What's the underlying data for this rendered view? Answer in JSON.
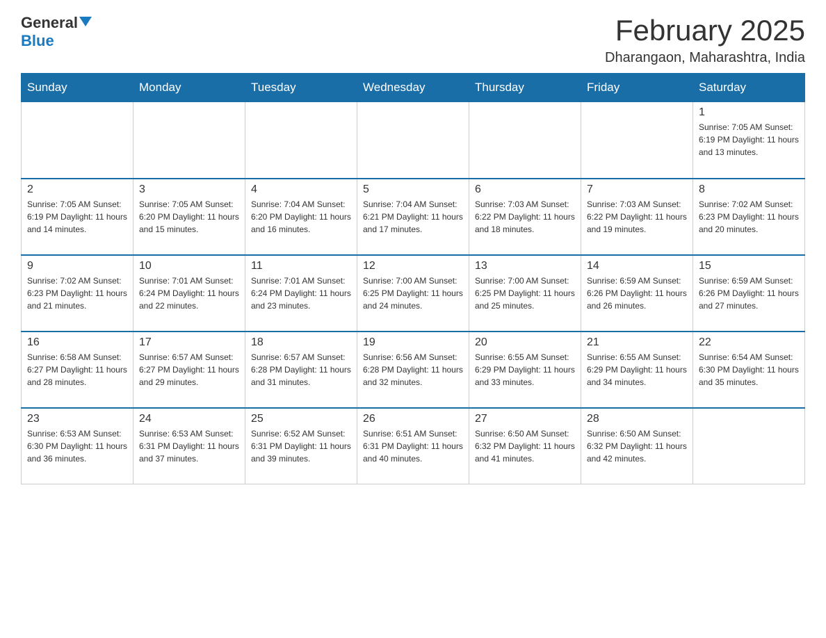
{
  "header": {
    "logo_general": "General",
    "logo_blue": "Blue",
    "month_title": "February 2025",
    "location": "Dharangaon, Maharashtra, India"
  },
  "days_of_week": [
    "Sunday",
    "Monday",
    "Tuesday",
    "Wednesday",
    "Thursday",
    "Friday",
    "Saturday"
  ],
  "weeks": [
    {
      "days": [
        {
          "num": "",
          "info": ""
        },
        {
          "num": "",
          "info": ""
        },
        {
          "num": "",
          "info": ""
        },
        {
          "num": "",
          "info": ""
        },
        {
          "num": "",
          "info": ""
        },
        {
          "num": "",
          "info": ""
        },
        {
          "num": "1",
          "info": "Sunrise: 7:05 AM\nSunset: 6:19 PM\nDaylight: 11 hours and 13 minutes."
        }
      ]
    },
    {
      "days": [
        {
          "num": "2",
          "info": "Sunrise: 7:05 AM\nSunset: 6:19 PM\nDaylight: 11 hours and 14 minutes."
        },
        {
          "num": "3",
          "info": "Sunrise: 7:05 AM\nSunset: 6:20 PM\nDaylight: 11 hours and 15 minutes."
        },
        {
          "num": "4",
          "info": "Sunrise: 7:04 AM\nSunset: 6:20 PM\nDaylight: 11 hours and 16 minutes."
        },
        {
          "num": "5",
          "info": "Sunrise: 7:04 AM\nSunset: 6:21 PM\nDaylight: 11 hours and 17 minutes."
        },
        {
          "num": "6",
          "info": "Sunrise: 7:03 AM\nSunset: 6:22 PM\nDaylight: 11 hours and 18 minutes."
        },
        {
          "num": "7",
          "info": "Sunrise: 7:03 AM\nSunset: 6:22 PM\nDaylight: 11 hours and 19 minutes."
        },
        {
          "num": "8",
          "info": "Sunrise: 7:02 AM\nSunset: 6:23 PM\nDaylight: 11 hours and 20 minutes."
        }
      ]
    },
    {
      "days": [
        {
          "num": "9",
          "info": "Sunrise: 7:02 AM\nSunset: 6:23 PM\nDaylight: 11 hours and 21 minutes."
        },
        {
          "num": "10",
          "info": "Sunrise: 7:01 AM\nSunset: 6:24 PM\nDaylight: 11 hours and 22 minutes."
        },
        {
          "num": "11",
          "info": "Sunrise: 7:01 AM\nSunset: 6:24 PM\nDaylight: 11 hours and 23 minutes."
        },
        {
          "num": "12",
          "info": "Sunrise: 7:00 AM\nSunset: 6:25 PM\nDaylight: 11 hours and 24 minutes."
        },
        {
          "num": "13",
          "info": "Sunrise: 7:00 AM\nSunset: 6:25 PM\nDaylight: 11 hours and 25 minutes."
        },
        {
          "num": "14",
          "info": "Sunrise: 6:59 AM\nSunset: 6:26 PM\nDaylight: 11 hours and 26 minutes."
        },
        {
          "num": "15",
          "info": "Sunrise: 6:59 AM\nSunset: 6:26 PM\nDaylight: 11 hours and 27 minutes."
        }
      ]
    },
    {
      "days": [
        {
          "num": "16",
          "info": "Sunrise: 6:58 AM\nSunset: 6:27 PM\nDaylight: 11 hours and 28 minutes."
        },
        {
          "num": "17",
          "info": "Sunrise: 6:57 AM\nSunset: 6:27 PM\nDaylight: 11 hours and 29 minutes."
        },
        {
          "num": "18",
          "info": "Sunrise: 6:57 AM\nSunset: 6:28 PM\nDaylight: 11 hours and 31 minutes."
        },
        {
          "num": "19",
          "info": "Sunrise: 6:56 AM\nSunset: 6:28 PM\nDaylight: 11 hours and 32 minutes."
        },
        {
          "num": "20",
          "info": "Sunrise: 6:55 AM\nSunset: 6:29 PM\nDaylight: 11 hours and 33 minutes."
        },
        {
          "num": "21",
          "info": "Sunrise: 6:55 AM\nSunset: 6:29 PM\nDaylight: 11 hours and 34 minutes."
        },
        {
          "num": "22",
          "info": "Sunrise: 6:54 AM\nSunset: 6:30 PM\nDaylight: 11 hours and 35 minutes."
        }
      ]
    },
    {
      "days": [
        {
          "num": "23",
          "info": "Sunrise: 6:53 AM\nSunset: 6:30 PM\nDaylight: 11 hours and 36 minutes."
        },
        {
          "num": "24",
          "info": "Sunrise: 6:53 AM\nSunset: 6:31 PM\nDaylight: 11 hours and 37 minutes."
        },
        {
          "num": "25",
          "info": "Sunrise: 6:52 AM\nSunset: 6:31 PM\nDaylight: 11 hours and 39 minutes."
        },
        {
          "num": "26",
          "info": "Sunrise: 6:51 AM\nSunset: 6:31 PM\nDaylight: 11 hours and 40 minutes."
        },
        {
          "num": "27",
          "info": "Sunrise: 6:50 AM\nSunset: 6:32 PM\nDaylight: 11 hours and 41 minutes."
        },
        {
          "num": "28",
          "info": "Sunrise: 6:50 AM\nSunset: 6:32 PM\nDaylight: 11 hours and 42 minutes."
        },
        {
          "num": "",
          "info": ""
        }
      ]
    }
  ]
}
